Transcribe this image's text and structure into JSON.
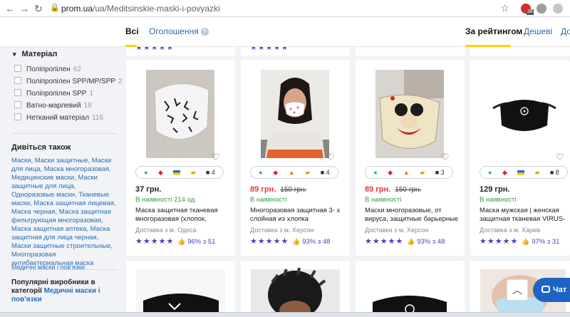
{
  "browser": {
    "url_host": "prom.ua",
    "url_path": "/ua/Meditsinskie-maski-i-povyazki",
    "ext_badge": "38"
  },
  "tabs": {
    "all": "Всі",
    "ads": "Оголошення",
    "help": "?",
    "by_rating": "За рейтингом",
    "cheaper": "Дешеві",
    "expensive": "Дор"
  },
  "sidebar": {
    "material_title": "Матеріал",
    "materials": [
      {
        "label": "Поліпропілен",
        "count": "62"
      },
      {
        "label": "Поліпропілен SPP/MP/SPP",
        "count": "2"
      },
      {
        "label": "Поліпропілен SPP",
        "count": "1"
      },
      {
        "label": "Ватно-марлевий",
        "count": "18"
      },
      {
        "label": "Нетканий матеріал",
        "count": "116"
      }
    ],
    "also_title": "Дивіться також",
    "also_text": "Маски, Маски защитные, Маски для лица, Маска многоразовая, Медицинские маски, Маски защитные для лица, Одноразовые маски, Тканевые маски, Маска защитная лицевая, Маска черная, Маска защитная фильтрующая многоразовая, Маска защитная аптека, Маска защитная для лица черная, Маски защитные строительные, Многоразовая антибактериальная маска",
    "popular_prefix": "Популярні виробники в категорії",
    "popular_link": "Медичні маски і пов'язки",
    "cutoff": "Медичні маски і пов'язки"
  },
  "products": [
    {
      "price": "37 грн.",
      "old_price": "",
      "availability": "В наявності 214 од.",
      "title": "Маска защитная тканевая многоразовая (хлопок,",
      "delivery": "Доставка з м. Одеса",
      "stars": "★★★★★",
      "percent": "96% з 51",
      "badge_count": "4"
    },
    {
      "price": "89 грн.",
      "old_price": "150 грн.",
      "availability": "В наявності",
      "title": "Многоразовая защитная 3- х слойная из хлопка",
      "delivery": "Доставка з м. Херсон",
      "stars": "★★★★★",
      "percent": "93% з 48",
      "badge_count": "4"
    },
    {
      "price": "89 грн.",
      "old_price": "150 грн.",
      "availability": "В наявності",
      "title": "Маски многоразовые, от вируса, защитные барьерные",
      "delivery": "Доставка з м. Херсон",
      "stars": "★★★★★",
      "percent": "93% з 48",
      "badge_count": "3"
    },
    {
      "price": "129 грн.",
      "old_price": "",
      "availability": "В наявності",
      "title": "Маска мужская | женская защитная тканевая VIRUS-",
      "delivery": "Доставка з м. Харків",
      "stars": "★★★★★",
      "percent": "97% з 31",
      "badge_count": "8"
    }
  ],
  "chat": {
    "label": "Чат"
  },
  "colors": {
    "accent_yellow": "#ffd400",
    "link_blue": "#2c6db5",
    "sale_red": "#e23b3b",
    "rating_purple": "#4e3dbf",
    "in_stock_green": "#339d3c"
  }
}
